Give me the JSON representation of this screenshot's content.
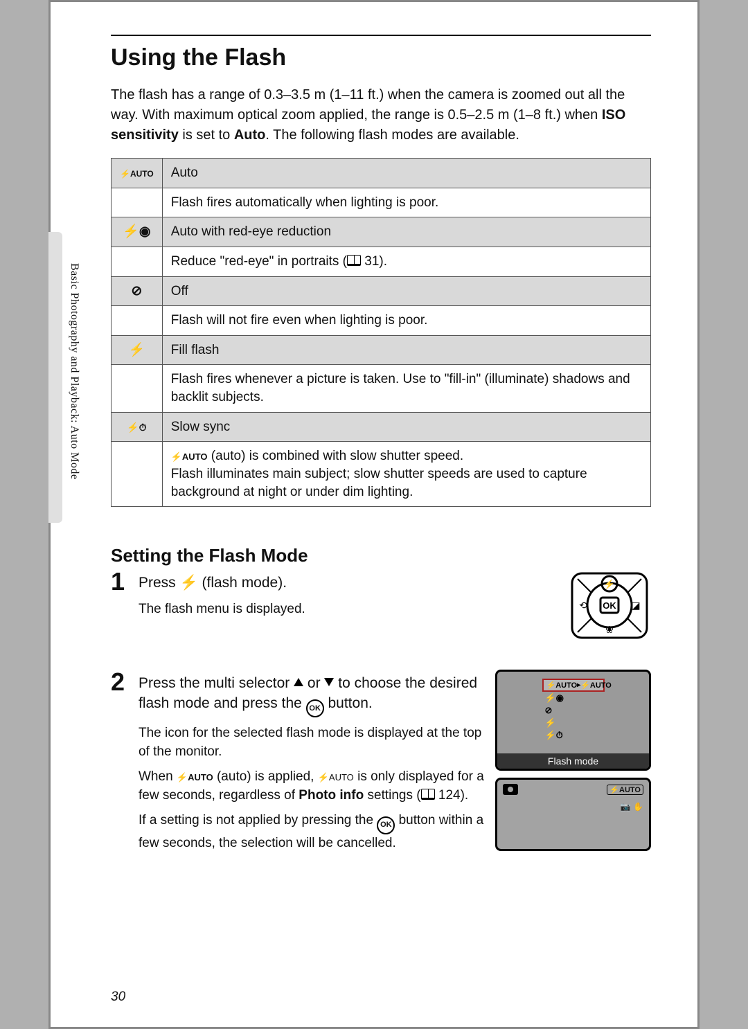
{
  "title": "Using the Flash",
  "intro_pre": "The flash has a range of 0.3–3.5 m (1–11 ft.) when the camera is zoomed out all the way. With maximum optical zoom applied, the range is 0.5–2.5 m (1–8 ft.) when ",
  "intro_iso": "ISO sensitivity",
  "intro_mid": " is set to ",
  "intro_auto": "Auto",
  "intro_post": ". The following flash modes are available.",
  "modes": [
    {
      "icon": "⚡AUTO",
      "name": "Auto",
      "desc": "Flash fires automatically when lighting is poor."
    },
    {
      "icon": "⚡◉",
      "name": "Auto with red-eye reduction",
      "desc_pre": "Reduce \"red-eye\" in portraits (",
      "desc_ref": "31",
      "desc_post": ")."
    },
    {
      "icon": "⊘",
      "name": "Off",
      "desc": "Flash will not fire even when lighting is poor."
    },
    {
      "icon": "⚡",
      "name": "Fill flash",
      "desc": "Flash fires whenever a picture is taken. Use to \"fill-in\" (illuminate) shadows and backlit subjects."
    },
    {
      "icon": "⚡⏱",
      "name": "Slow sync",
      "desc_icon": "⚡AUTO",
      "desc": " (auto) is combined with slow shutter speed.\nFlash illuminates main subject; slow shutter speeds are used to capture background at night or under dim lighting."
    }
  ],
  "sidebar": "Basic Photography and Playback: Auto Mode",
  "subheading": "Setting the Flash Mode",
  "step1": {
    "num": "1",
    "title_pre": "Press ",
    "title_post": " (flash mode).",
    "text": "The flash menu is displayed."
  },
  "step2": {
    "num": "2",
    "title_pre": "Press the multi selector ",
    "title_mid": " or ",
    "title_mid2": " to choose the desired flash mode and press the ",
    "title_post": " button.",
    "text1": "The icon for the selected flash mode is displayed at the top of the monitor.",
    "text2_pre": "When ",
    "text2_icon1": "⚡AUTO",
    "text2_mid": " (auto) is applied, ",
    "text2_icon2": "⚡AUTO",
    "text2_mid2": " is only displayed for a few seconds, regardless of ",
    "text2_bold": "Photo info",
    "text2_mid3": " settings (",
    "text2_ref": "124",
    "text2_post": ").",
    "text3_pre": "If a setting is not applied by pressing the ",
    "text3_post": " button within a few seconds, the selection will be cancelled."
  },
  "lcd": {
    "menu": [
      "⚡AUTO",
      "⚡◉",
      "⊘",
      "⚡",
      "⚡⏱"
    ],
    "sel_right": "⚡AUTO",
    "caption": "Flash mode",
    "badge": "⚡AUTO"
  },
  "page_number": "30"
}
